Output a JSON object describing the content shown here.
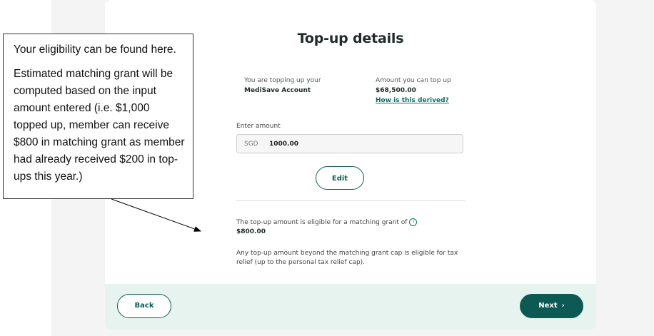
{
  "page": {
    "title": "Top-up details"
  },
  "account_info": {
    "label": "You are topping up your",
    "value": "MediSave Account"
  },
  "limit_info": {
    "label": "Amount you can top up",
    "value": "$68,500.00",
    "link": "How is this derived?"
  },
  "amount_field": {
    "label": "Enter amount",
    "currency": "SGD",
    "value": "1000.00"
  },
  "buttons": {
    "edit": "Edit",
    "back": "Back",
    "next": "Next",
    "next_icon": "chevron-right-icon"
  },
  "grant": {
    "text": "The top-up amount is eligible for a matching grant of",
    "info_icon": "i",
    "value": "$800.00"
  },
  "relief": {
    "text": "Any top-up amount beyond the matching grant cap is eligible for tax relief (up to the personal tax relief cap)."
  },
  "callout": {
    "line1": "Your eligibility can be found here.",
    "line2": "Estimated matching grant will be computed based on the input amount entered (i.e. $1,000 topped up, member can receive $800 in matching grant as member had already received $200 in top-ups this year.)"
  },
  "colors": {
    "primary": "#0d5a54",
    "footer_bg": "#e6f3ef",
    "link": "#0e6f63"
  }
}
